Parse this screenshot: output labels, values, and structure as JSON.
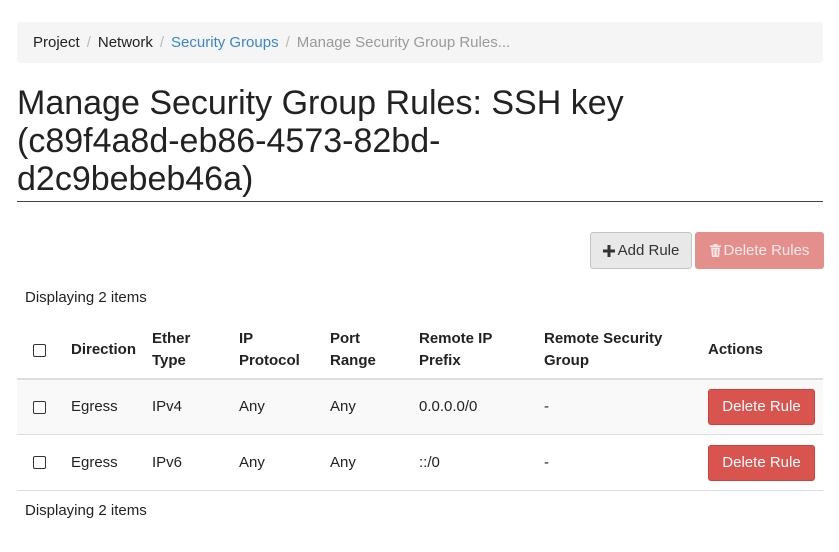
{
  "breadcrumb": {
    "items": [
      "Project",
      "Network",
      "Security Groups",
      "Manage Security Group Rules..."
    ]
  },
  "page": {
    "title_line1": "Manage Security Group Rules: SSH key",
    "title_line2": "(c89f4a8d-eb86-4573-82bd-",
    "title_line3": "d2c9bebeb46a)"
  },
  "toolbar": {
    "add_rule_label": "Add Rule",
    "delete_rules_label": "Delete Rules"
  },
  "table": {
    "count_top": "Displaying 2 items",
    "count_bottom": "Displaying 2 items",
    "headers": {
      "direction": "Direction",
      "ether_type_1": "Ether",
      "ether_type_2": "Type",
      "ip_protocol_1": "IP",
      "ip_protocol_2": "Protocol",
      "port_range_1": "Port",
      "port_range_2": "Range",
      "remote_ip_prefix_1": "Remote IP",
      "remote_ip_prefix_2": "Prefix",
      "remote_security_group_1": "Remote Security",
      "remote_security_group_2": "Group",
      "actions": "Actions"
    },
    "rows": [
      {
        "direction": "Egress",
        "ether_type": "IPv4",
        "ip_protocol": "Any",
        "port_range": "Any",
        "remote_ip_prefix": "0.0.0.0/0",
        "remote_security_group": "-",
        "action_label": "Delete Rule"
      },
      {
        "direction": "Egress",
        "ether_type": "IPv6",
        "ip_protocol": "Any",
        "port_range": "Any",
        "remote_ip_prefix": "::/0",
        "remote_security_group": "-",
        "action_label": "Delete Rule"
      }
    ]
  },
  "icons": {
    "add": "plus-icon",
    "delete": "trash-icon"
  },
  "colors": {
    "link": "#3a87c8",
    "danger": "#d9534f",
    "danger_disabled": "#e48f8c"
  }
}
